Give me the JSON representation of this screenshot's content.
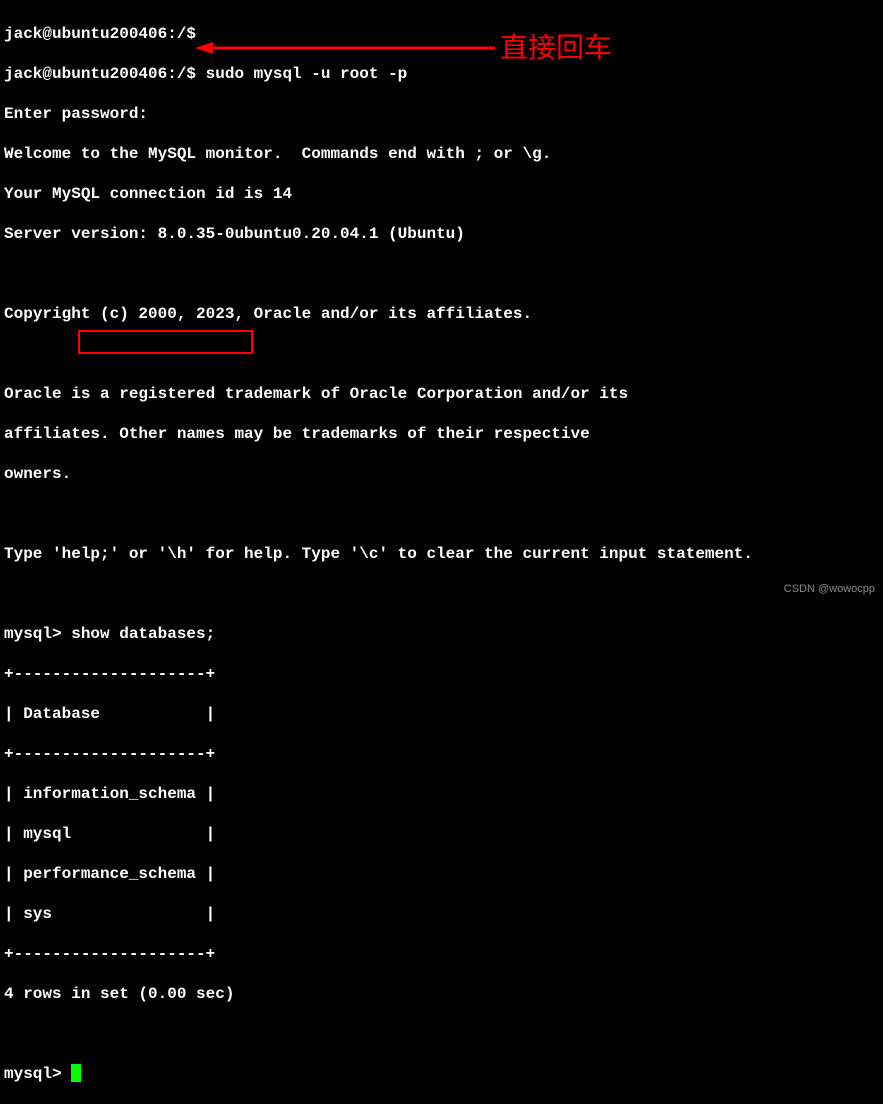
{
  "terminal": {
    "line1": "jack@ubuntu200406:/$",
    "line2": "jack@ubuntu200406:/$ sudo mysql -u root -p",
    "line3": "Enter password:",
    "line4": "Welcome to the MySQL monitor.  Commands end with ; or \\g.",
    "line5": "Your MySQL connection id is 14",
    "line6": "Server version: 8.0.35-0ubuntu0.20.04.1 (Ubuntu)",
    "line7": "",
    "line8": "Copyright (c) 2000, 2023, Oracle and/or its affiliates.",
    "line9": "",
    "line10": "Oracle is a registered trademark of Oracle Corporation and/or its",
    "line11": "affiliates. Other names may be trademarks of their respective",
    "line12": "owners.",
    "line13": "",
    "line14": "Type 'help;' or '\\h' for help. Type '\\c' to clear the current input statement.",
    "line15": "",
    "line16": "mysql> show databases;",
    "line17": "+--------------------+",
    "line18": "| Database           |",
    "line19": "+--------------------+",
    "line20": "| information_schema |",
    "line21": "| mysql              |",
    "line22": "| performance_schema |",
    "line23": "| sys                |",
    "line24": "+--------------------+",
    "line25": "4 rows in set (0.00 sec)",
    "line26": "",
    "line27": "mysql> "
  },
  "annotation": {
    "text": "直接回车"
  },
  "watermark": "CSDN @wowocpp"
}
